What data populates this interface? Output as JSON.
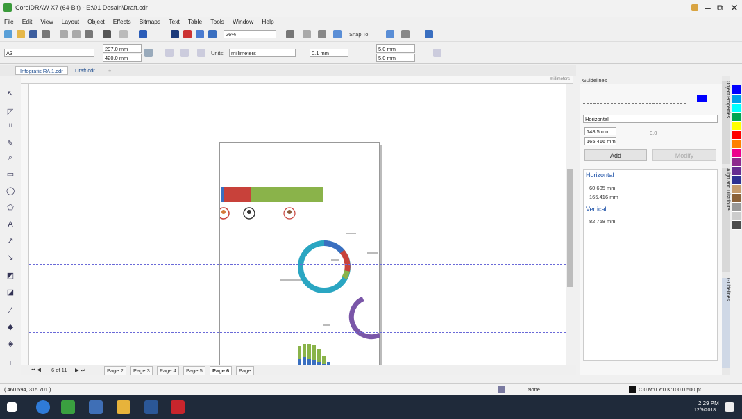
{
  "window": {
    "title": "CorelDRAW X7 (64-Bit) - E:\\01 Desain\\Draft.cdr"
  },
  "menu": [
    "File",
    "Edit",
    "View",
    "Layout",
    "Object",
    "Effects",
    "Bitmaps",
    "Text",
    "Table",
    "Tools",
    "Window",
    "Help"
  ],
  "toolbar": {
    "zoom": "26%",
    "snap_to": "Snap To"
  },
  "property_bar": {
    "paper": "A3",
    "width": "297.0 mm",
    "height": "420.0 mm",
    "units_label": "Units:",
    "units": "millimeters",
    "nudge": "0.1 mm",
    "dup_x": "5.0 mm",
    "dup_y": "5.0 mm"
  },
  "doc_tabs": [
    "Infografis RA 1.cdr",
    "Draft.cdr"
  ],
  "ruler_label": "millimeters",
  "page_nav": {
    "count_label": "6 of 11",
    "pages": [
      "Page 2",
      "Page 3",
      "Page 4",
      "Page 5",
      "Page 6",
      "Page"
    ]
  },
  "status": {
    "coords": "( 460.594, 315.701 )",
    "fill": "None",
    "outline": "C:0 M:0 Y:0 K:100  0.500 pt"
  },
  "docker": {
    "title": "Guidelines",
    "orientation": "Horizontal",
    "x_value": "148.5 mm",
    "y_value": "165.416 mm",
    "angle": "0.0",
    "add_label": "Add",
    "modify_label": "Modify",
    "groups": [
      {
        "name": "Horizontal",
        "items": [
          "60.605 mm",
          "165.416 mm"
        ]
      },
      {
        "name": "Vertical",
        "items": [
          "82.758 mm"
        ]
      }
    ],
    "side_tabs": [
      "Object Properties",
      "Align and Distribute",
      "Guidelines"
    ]
  },
  "colors": {
    "accent": "#0b4fa0",
    "palette": [
      "#0000ff",
      "#00a0e9",
      "#00ffff",
      "#00a651",
      "#ffff00",
      "#ff0000",
      "#ff7f00",
      "#ec008c",
      "#8e2a8e",
      "#662d91",
      "#2e3192",
      "#c69c6d",
      "#8c6239",
      "#999999",
      "#cccccc",
      "#4d4d4d"
    ]
  },
  "clock": {
    "time": "2:29 PM",
    "date": "12/9/2018"
  }
}
